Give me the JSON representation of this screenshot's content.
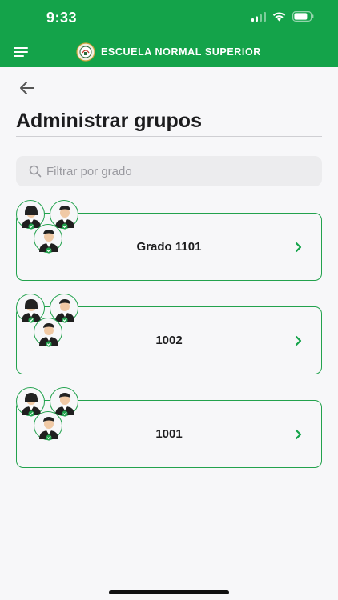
{
  "status_bar": {
    "time": "9:33"
  },
  "header": {
    "title": "ESCUELA NORMAL SUPERIOR",
    "logo_icon": "school-crest-logo",
    "brand_color": "#14a34a"
  },
  "page": {
    "title": "Administrar grupos"
  },
  "search": {
    "placeholder": "Filtrar por grado",
    "value": ""
  },
  "groups": [
    {
      "label": "Grado 1101"
    },
    {
      "label": "1002"
    },
    {
      "label": "1001"
    }
  ],
  "colors": {
    "accent": "#14a34a",
    "card_border": "#22a24d",
    "background": "#f7f7f9"
  }
}
